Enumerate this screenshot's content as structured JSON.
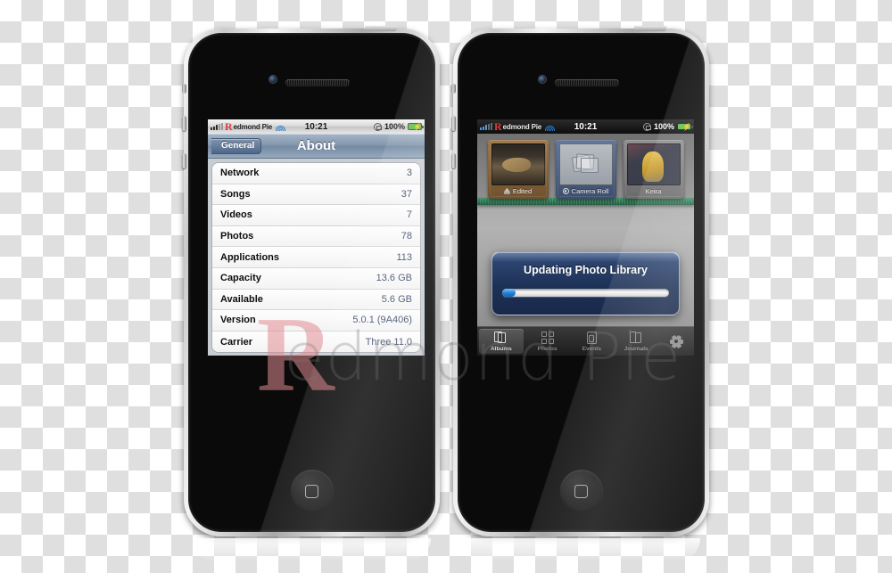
{
  "watermark": {
    "logo_letter": "R",
    "text": "edmond Pie",
    "color": "#e28c91"
  },
  "phones": {
    "left": {
      "name": "iphone-settings-about",
      "status_bar": {
        "signal_icon": "signal-bars-icon",
        "carrier_logo": "R",
        "carrier": "edmond Pie",
        "wifi_icon": "wifi-icon",
        "time": "10:21",
        "rotation_lock_icon": "rotation-lock-icon",
        "battery_percent": "100%",
        "battery_icon": "battery-charging-icon"
      },
      "nav": {
        "back_label": "General",
        "title": "About"
      },
      "rows": [
        {
          "key": "Network",
          "value": "3"
        },
        {
          "key": "Songs",
          "value": "37"
        },
        {
          "key": "Videos",
          "value": "7"
        },
        {
          "key": "Photos",
          "value": "78"
        },
        {
          "key": "Applications",
          "value": "113"
        },
        {
          "key": "Capacity",
          "value": "13.6 GB"
        },
        {
          "key": "Available",
          "value": "5.6 GB"
        },
        {
          "key": "Version",
          "value": "5.0.1 (9A406)"
        },
        {
          "key": "Carrier",
          "value": "Three 11.0"
        }
      ]
    },
    "right": {
      "name": "iphone-photos-app",
      "status_bar": {
        "signal_icon": "signal-bars-icon",
        "carrier_logo": "R",
        "carrier": "edmond Pie",
        "wifi_icon": "wifi-icon",
        "time": "10:21",
        "rotation_lock_icon": "rotation-lock-icon",
        "battery_percent": "100%",
        "battery_icon": "battery-charging-icon"
      },
      "albums": [
        {
          "label": "Edited",
          "icon": "edited-icon",
          "cover": "dog-photo"
        },
        {
          "label": "Camera Roll",
          "icon": "camera-roll-icon",
          "cover": "empty-stack"
        },
        {
          "label": "Keira",
          "icon": "",
          "cover": "keira-photo"
        }
      ],
      "dialog": {
        "title": "Updating Photo Library",
        "progress_percent": 8
      },
      "tabs": [
        {
          "label": "Albums",
          "icon": "albums-icon",
          "selected": true
        },
        {
          "label": "Photos",
          "icon": "photos-grid-icon",
          "selected": false
        },
        {
          "label": "Events",
          "icon": "events-icon",
          "selected": false
        },
        {
          "label": "Journals",
          "icon": "journals-icon",
          "selected": false
        }
      ],
      "settings_icon": "gear-icon"
    }
  }
}
